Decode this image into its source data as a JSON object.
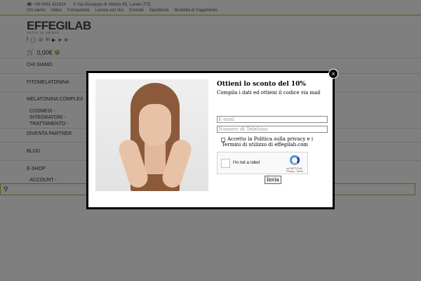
{
  "header": {
    "phone": "+39 0431 421614",
    "address": "Via Giuseppe di Vittorio 65, Lurate (TS)",
    "links": [
      "Chi siamo",
      "Video",
      "Formazione",
      "Lavora con Noi",
      "Contatti",
      "Spedizioni",
      "Modalità di Pagamento"
    ],
    "logo": "EFFEGILAB",
    "tagline": "nutre la salute",
    "social_icons": [
      "facebook-icon",
      "instagram-icon",
      "whatsapp-icon",
      "linkedin-icon",
      "youtube-icon",
      "telegram-icon",
      "rss-icon"
    ],
    "cart_total": "0,00€",
    "cart_count": "0"
  },
  "nav": {
    "chi_siamo": "CHI SIAMO",
    "fitomelatonina": "FITOMELATONINA",
    "melatonina_complex": "MELATONINA COMPLEX",
    "cosmesi_1": "COSMESI -",
    "cosmesi_2": "INTEGRATORI -",
    "cosmesi_3": "TRATTAMENTO -",
    "diventa_partner": "DIVENTA PARTNER",
    "blog": "BLOG",
    "eshop": "E-SHOP",
    "account": "ACCOUNT -"
  },
  "popup": {
    "title": "Ottieni lo sconto del 10%",
    "subtitle": "Compila i dati ed ottieni il codice via mail",
    "email_placeholder": "E-mail",
    "phone_placeholder": "Numero di Telefono",
    "privacy_line1": "Accetto la Politica sulla privacy e i",
    "privacy_line2": "Termini di utilizzo di effegilab.com",
    "captcha_label": "I'm not a robot",
    "captcha_brand": "reCAPTCHA",
    "captcha_links": "Privacy - Terms",
    "submit_label": "Invia"
  }
}
